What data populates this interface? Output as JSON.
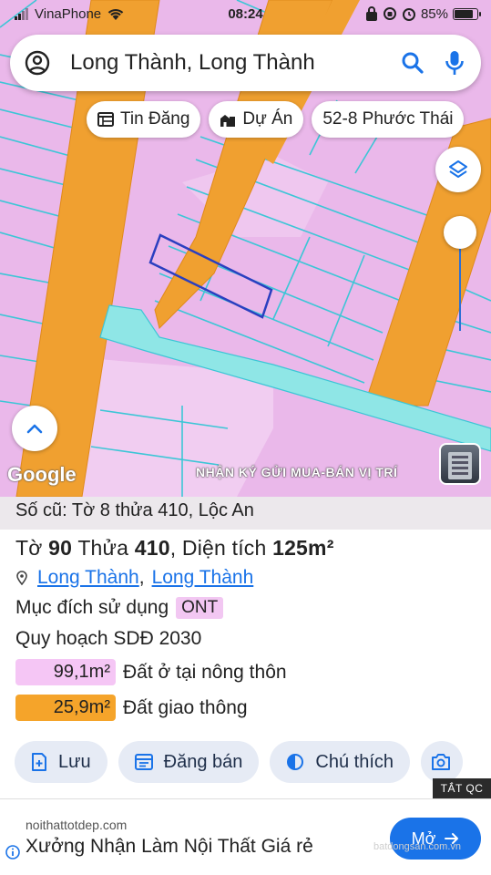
{
  "status_bar": {
    "carrier": "VinaPhone",
    "time": "08:24",
    "battery": "85%",
    "battery_level": 0.85
  },
  "search": {
    "text": "Long Thành, Long Thành"
  },
  "chips": [
    {
      "label": "Tin Đăng",
      "icon": "listing-icon"
    },
    {
      "label": "Dự Án",
      "icon": "building-icon"
    },
    {
      "label": "52-8 Phước Thái",
      "icon": ""
    }
  ],
  "map": {
    "google_label": "Google",
    "banner": "NHẬN KÝ GỬI MUA-BÁN VỊ TRÍ"
  },
  "parcel": {
    "old_ref": "Số cũ: Tờ 8 thửa 410, Lộc An",
    "to_label": "Tờ",
    "to_value": "90",
    "thua_label": "Thửa",
    "thua_value": "410",
    "area_label": ", Diện tích",
    "area_value": "125m²",
    "location_1": "Long Thành",
    "location_sep": ",",
    "location_2": "Long Thành",
    "purpose_label": "Mục đích sử dụng",
    "purpose_code": "ONT",
    "plan_label": "Quy hoạch SDĐ 2030",
    "land_uses": [
      {
        "area": "99,1m²",
        "label": "Đất ở tại nông thôn",
        "color": "#f5c6f5"
      },
      {
        "area": "25,9m²",
        "label": "Đất giao thông",
        "color": "#f5a42a"
      }
    ]
  },
  "actions": [
    {
      "label": "Lưu",
      "icon": "save-icon"
    },
    {
      "label": "Đăng bán",
      "icon": "post-icon"
    },
    {
      "label": "Chú thích",
      "icon": "legend-icon"
    }
  ],
  "ad": {
    "tag": "TẮT QC",
    "domain": "noithattotdep.com",
    "title": "Xưởng Nhận Làm Nội Thất Giá rẻ",
    "cta": "Mở"
  },
  "watermark": "batdongsan.com.vn",
  "colors": {
    "residential": "#eab8ea",
    "road": "#f0a030",
    "parcel_line": "#3cc6d6",
    "selected_outline": "#2a3fc0",
    "accent": "#1a73e8"
  }
}
